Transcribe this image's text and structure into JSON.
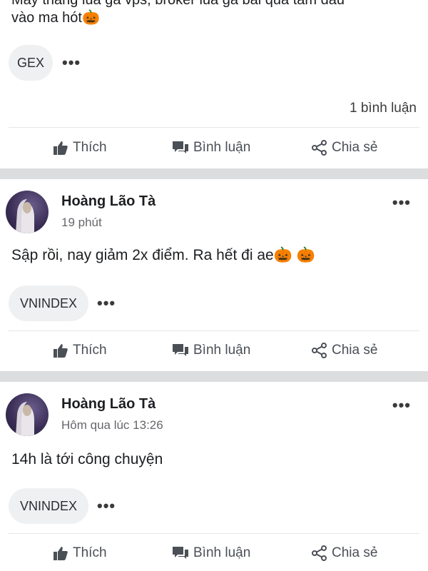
{
  "post1": {
    "text_line1": "Mấy tháng lùa gà vps, broker lùa gà bài quá tâm đâu",
    "text_line2": "vào ma hót",
    "emoji": "🎃",
    "tag": "GEX",
    "comment_count": "1 bình luận"
  },
  "actions": {
    "like": "Thích",
    "comment": "Bình luận",
    "share": "Chia sẻ"
  },
  "post2": {
    "author": "Hoàng Lão Tà",
    "time": "19 phút",
    "text": "Sập rồi, nay giảm 2x điểm. Ra hết đi ae",
    "emojis": "🎃 🎃",
    "tag": "VNINDEX"
  },
  "post3": {
    "author": "Hoàng Lão Tà",
    "time": "Hôm qua lúc 13:26",
    "text": "14h là tới công chuyện",
    "tag": "VNINDEX"
  },
  "ui": {
    "more": "•••"
  }
}
